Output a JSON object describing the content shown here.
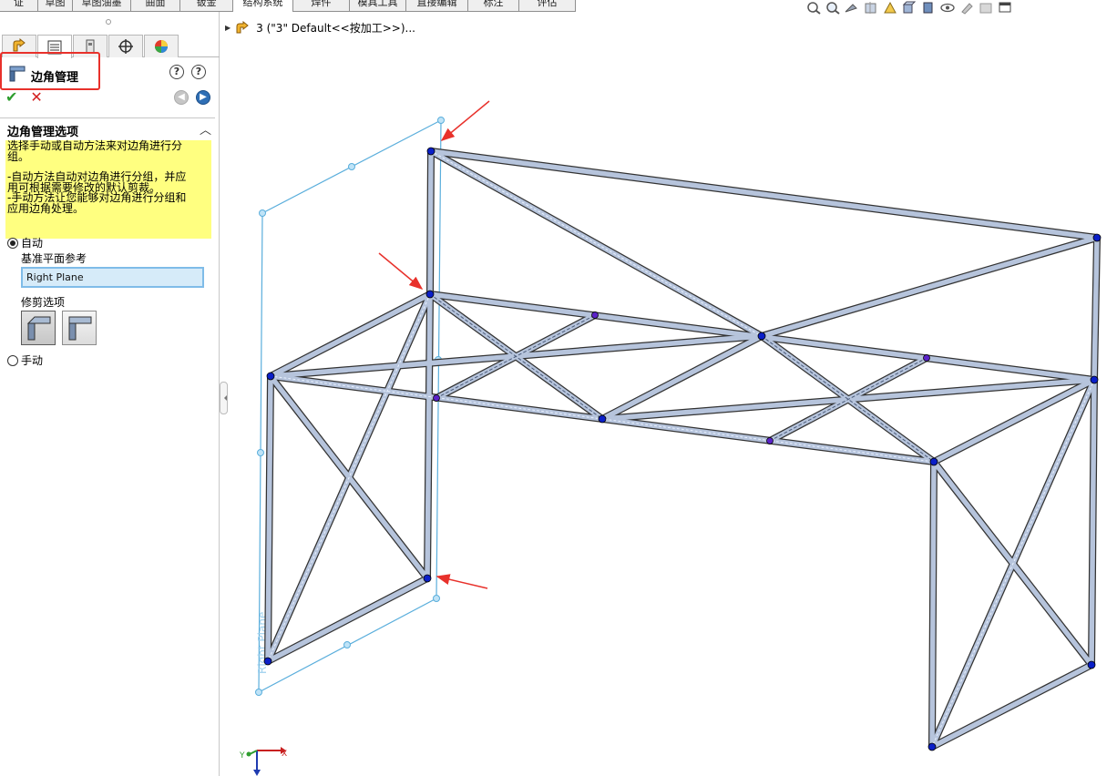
{
  "ribbon": {
    "tabs": [
      {
        "label": "证",
        "width": 42
      },
      {
        "label": "草图",
        "width": 38
      },
      {
        "label": "草图油墨",
        "width": 64
      },
      {
        "label": "曲面",
        "width": 54
      },
      {
        "label": "钣金",
        "width": 58
      },
      {
        "label": "结构系统",
        "width": 66,
        "active": true
      },
      {
        "label": "焊件",
        "width": 62
      },
      {
        "label": "模具工具",
        "width": 62
      },
      {
        "label": "直接编辑",
        "width": 68
      },
      {
        "label": "标注",
        "width": 56
      },
      {
        "label": "评估",
        "width": 62
      }
    ]
  },
  "tree": {
    "label": "3 (\"3\" Default<<按加工>>)..."
  },
  "property_manager": {
    "title": "边角管理",
    "help_label": "?",
    "help2_label": "?",
    "ok_label": "✔",
    "cancel_label": "✕",
    "group_title": "边角管理选项",
    "message": {
      "line1": "选择手动或自动方法来对边角进行分",
      "line2": "组。",
      "line3": "-自动方法自动对边角进行分组，并应",
      "line4": "用可根据需要修改的默认剪裁。",
      "line5": "-手动方法让您能够对边角进行分组和",
      "line6": "应用边角处理。"
    },
    "radio_auto_label": "自动",
    "ref_label": "基准平面参考",
    "ref_value": "Right Plane",
    "trim_label": "修剪选项",
    "radio_manual_label": "手动"
  },
  "viewport": {
    "plane_label": "Right Plane"
  },
  "triad": {
    "x_label": "X",
    "y_label": "Y"
  },
  "colors": {
    "highlight": "#e8312b",
    "message_bg": "#ffff80",
    "input_bg": "#d6ebf9",
    "plane": "#5aaedc",
    "vertex": "#0a1fc8",
    "vertex_mid": "#5a22c8",
    "member": "#b6c4dc"
  }
}
